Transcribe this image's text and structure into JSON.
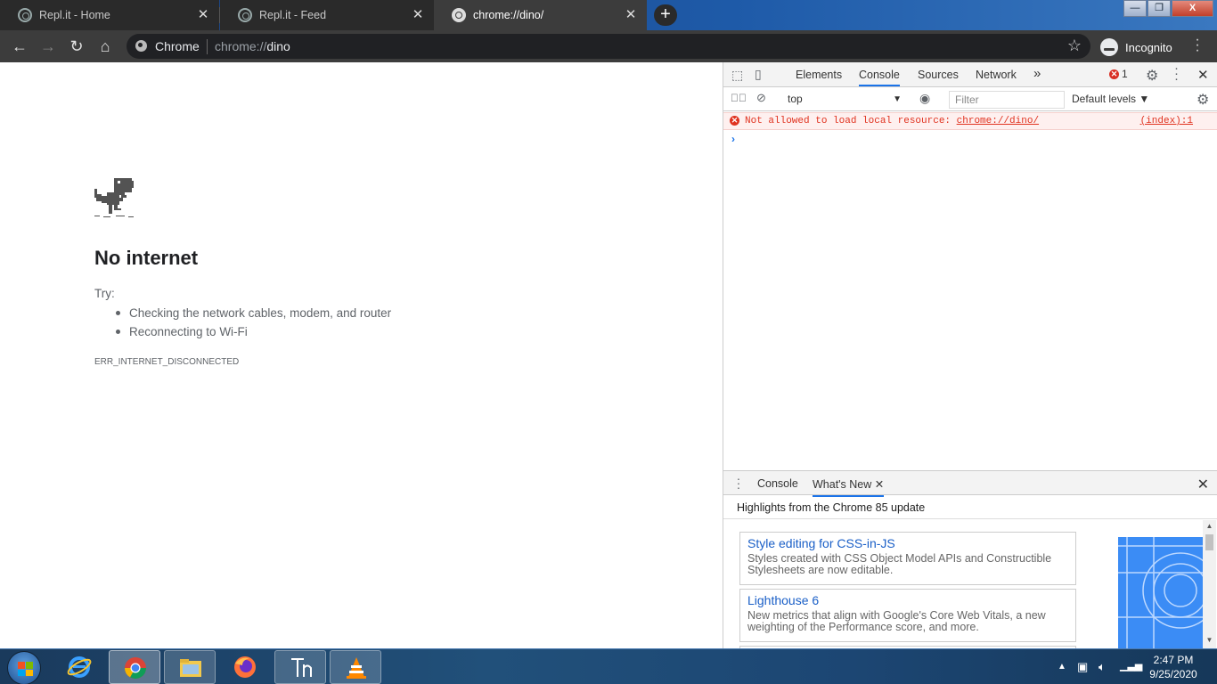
{
  "browser": {
    "tabs": [
      {
        "title": "Repl.it - Home",
        "active": false
      },
      {
        "title": "Repl.it - Feed",
        "active": false
      },
      {
        "title": "chrome://dino/",
        "active": true
      }
    ],
    "new_tab_symbol": "+",
    "window_controls": {
      "minimize": "—",
      "maximize": "❐",
      "close": "X"
    },
    "omnibox": {
      "chip": "Chrome",
      "url_scheme": "chrome://",
      "url_host": "dino"
    },
    "profile_label": "Incognito"
  },
  "page": {
    "heading": "No internet",
    "try_label": "Try:",
    "suggestions": [
      "Checking the network cables, modem, and router",
      "Reconnecting to Wi-Fi"
    ],
    "error_code": "ERR_INTERNET_DISCONNECTED"
  },
  "devtools": {
    "tabs": [
      "Elements",
      "Console",
      "Sources",
      "Network"
    ],
    "more_tabs": "»",
    "error_count": "1",
    "context": "top",
    "filter_placeholder": "Filter",
    "levels": "Default levels ▼",
    "console_error": {
      "message": "Not allowed to load local resource: ",
      "link": "chrome://dino/",
      "source": "(index):1"
    },
    "prompt": "›",
    "drawer": {
      "tabs": [
        "Console",
        "What's New"
      ],
      "highlights": "Highlights from the Chrome 85 update",
      "cards": [
        {
          "title": "Style editing for CSS-in-JS",
          "desc": "Styles created with CSS Object Model APIs and Constructible Stylesheets are now editable."
        },
        {
          "title": "Lighthouse 6",
          "desc": "New metrics that align with Google's Core Web Vitals, a new weighting of the Performance score, and more."
        }
      ]
    }
  },
  "taskbar": {
    "apps": [
      "chrome-icon",
      "internet-explorer-icon",
      "file-explorer-icon",
      "firefox-icon",
      "typora-icon",
      "vlc-icon"
    ],
    "time": "2:47 PM",
    "date": "9/25/2020"
  },
  "colors": {
    "accent": "#1a73e8",
    "error": "#e0321f",
    "toolbar": "#3c3c3c"
  }
}
